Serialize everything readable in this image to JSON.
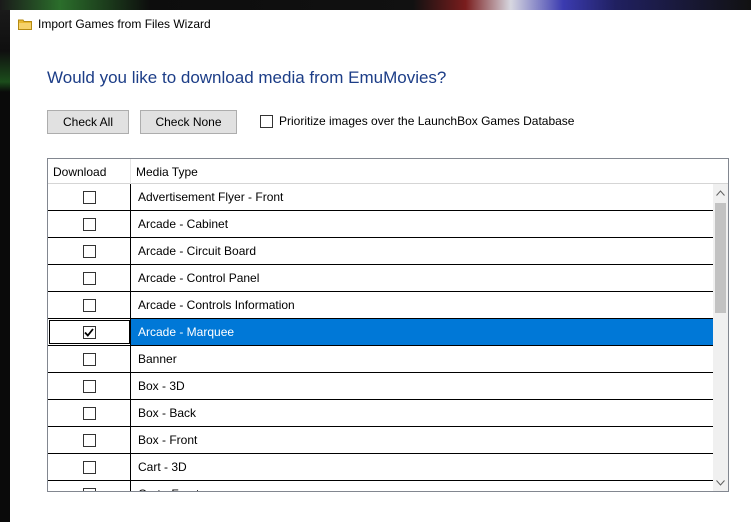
{
  "window": {
    "title": "Import Games from Files Wizard"
  },
  "heading": "Would you like to download media from EmuMovies?",
  "buttons": {
    "check_all": "Check All",
    "check_none": "Check None"
  },
  "prioritize": {
    "label": "Prioritize images over the LaunchBox Games Database",
    "checked": false
  },
  "grid": {
    "columns": [
      "Download",
      "Media Type"
    ],
    "rows": [
      {
        "media": "Advertisement Flyer - Front",
        "checked": false
      },
      {
        "media": "Arcade - Cabinet",
        "checked": false
      },
      {
        "media": "Arcade - Circuit Board",
        "checked": false
      },
      {
        "media": "Arcade - Control Panel",
        "checked": false
      },
      {
        "media": "Arcade - Controls Information",
        "checked": false
      },
      {
        "media": "Arcade - Marquee",
        "checked": true,
        "selected": true
      },
      {
        "media": "Banner",
        "checked": false
      },
      {
        "media": "Box - 3D",
        "checked": false
      },
      {
        "media": "Box - Back",
        "checked": false
      },
      {
        "media": "Box - Front",
        "checked": false
      },
      {
        "media": "Cart - 3D",
        "checked": false
      },
      {
        "media": "Cart - Front",
        "checked": false
      }
    ]
  },
  "icons": {
    "title": "folder-icon",
    "check": "checkmark-icon",
    "scroll_up": "chevron-up-icon",
    "scroll_down": "chevron-down-icon"
  },
  "colors": {
    "heading": "#1c3d87",
    "selection": "#0078d7"
  }
}
